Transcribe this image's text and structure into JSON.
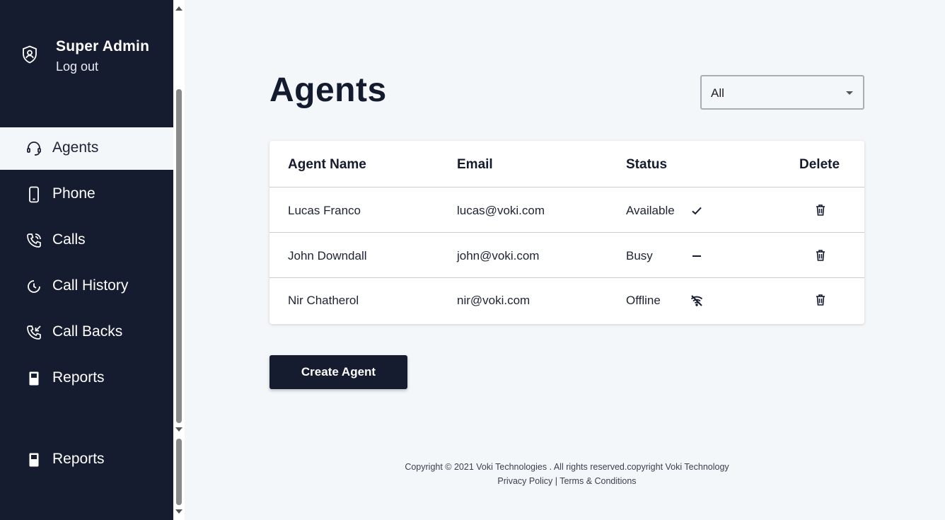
{
  "user": {
    "name": "Super Admin",
    "logout_label": "Log out"
  },
  "nav": [
    {
      "label": "Agents",
      "icon": "headset-icon"
    },
    {
      "label": "Phone",
      "icon": "phone-icon"
    },
    {
      "label": "Calls",
      "icon": "call-icon"
    },
    {
      "label": "Call History",
      "icon": "history-icon"
    },
    {
      "label": "Call Backs",
      "icon": "callback-icon"
    },
    {
      "label": "Reports",
      "icon": "report-icon"
    }
  ],
  "bottom_nav": {
    "label": "Reports",
    "icon": "report-icon"
  },
  "page_title": "Agents",
  "filter": {
    "value": "All"
  },
  "table": {
    "headers": [
      "Agent Name",
      "Email",
      "Status",
      "Delete"
    ],
    "rows": [
      {
        "name": "Lucas Franco",
        "email": "lucas@voki.com",
        "status": "Available",
        "status_icon": "check-icon"
      },
      {
        "name": "John Downdall",
        "email": "john@voki.com",
        "status": "Busy",
        "status_icon": "dash-icon"
      },
      {
        "name": "Nir Chatherol",
        "email": "nir@voki.com",
        "status": "Offline",
        "status_icon": "wifi-off-icon"
      }
    ]
  },
  "create_button": "Create Agent",
  "footer": {
    "copyright": "Copyright © 2021 Voki Technologies . All rights reserved.copyright Voki Technology",
    "privacy": "Privacy Policy",
    "separator": " | ",
    "terms": "Terms & Conditions"
  },
  "colors": {
    "sidebar_bg": "#161c30",
    "page_bg": "#f3f7fa",
    "button_bg": "#161c30"
  }
}
